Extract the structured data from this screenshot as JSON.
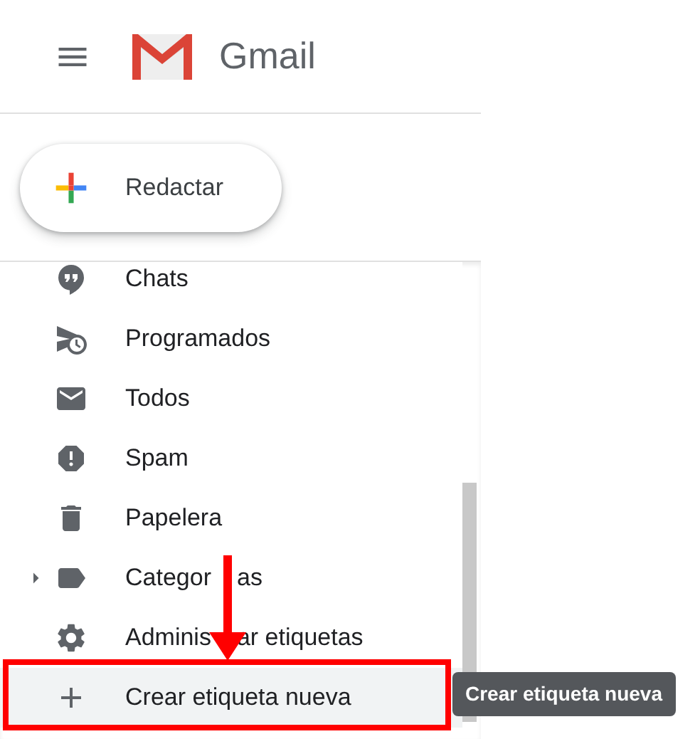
{
  "header": {
    "title": "Gmail"
  },
  "compose": {
    "label": "Redactar"
  },
  "nav": [
    {
      "label_parts": [
        "Chats"
      ],
      "kind": "chat",
      "selected": false,
      "has_children": false
    },
    {
      "label_parts": [
        "Programados"
      ],
      "kind": "scheduled",
      "selected": false,
      "has_children": false
    },
    {
      "label_parts": [
        "Todos"
      ],
      "kind": "mail",
      "selected": false,
      "has_children": false
    },
    {
      "label_parts": [
        "Spam"
      ],
      "kind": "spam",
      "selected": false,
      "has_children": false
    },
    {
      "label_parts": [
        "Papelera"
      ],
      "kind": "trash",
      "selected": false,
      "has_children": false
    },
    {
      "label_parts": [
        "Categor",
        "as"
      ],
      "kind": "label",
      "selected": false,
      "has_children": true
    },
    {
      "label_parts": [
        "Adminis",
        "ar etiquetas"
      ],
      "kind": "settings",
      "selected": false,
      "has_children": false
    },
    {
      "label_parts": [
        "Crear etiqueta nueva"
      ],
      "kind": "add",
      "selected": true,
      "has_children": false
    }
  ],
  "tooltip": {
    "text": "Crear etiqueta nueva"
  }
}
